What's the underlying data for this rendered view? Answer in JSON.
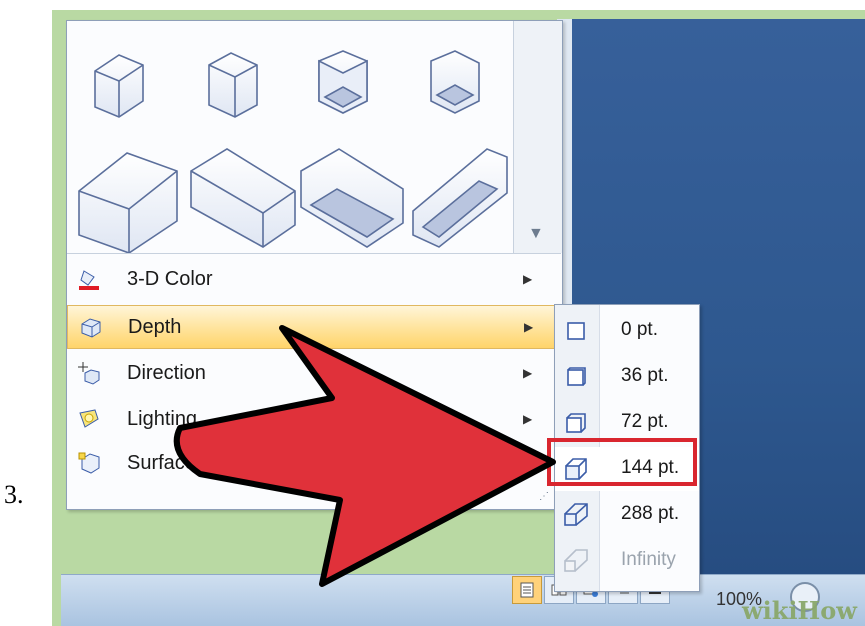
{
  "step_number": "3.",
  "menu": {
    "items": [
      {
        "label": "3-D Color",
        "icon": "paint-bucket-icon"
      },
      {
        "label": "Depth",
        "icon": "depth-cube-icon"
      },
      {
        "label": "Direction",
        "icon": "direction-cube-icon"
      },
      {
        "label": "Lighting",
        "icon": "lighting-bulb-icon"
      },
      {
        "label": "Surface",
        "icon": "surface-cube-icon"
      }
    ]
  },
  "depth_submenu": {
    "items": [
      {
        "label": "0 pt."
      },
      {
        "label": "36 pt."
      },
      {
        "label": "72 pt."
      },
      {
        "label": "144 pt.",
        "selected": true
      },
      {
        "label": "288 pt."
      },
      {
        "label": "Infinity",
        "disabled": true
      }
    ]
  },
  "status_bar": {
    "zoom": "100%",
    "watermark": "wikiHow"
  },
  "colors": {
    "highlight": "#ffd46a",
    "selection_box": "#d9262f",
    "arrow": "#e0313a",
    "document": "#2e588f",
    "frame": "#b9d9a3"
  }
}
